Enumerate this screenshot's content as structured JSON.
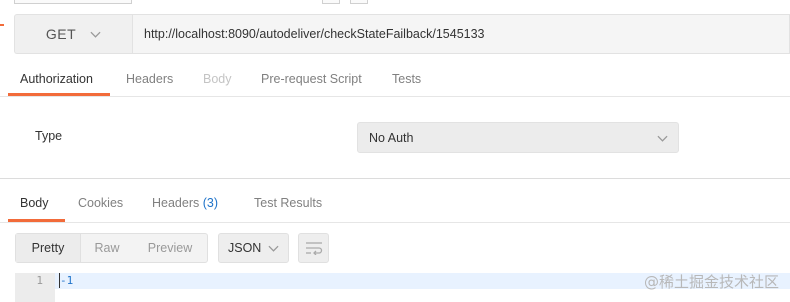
{
  "request": {
    "method": "GET",
    "url": "http://localhost:8090/autodeliver/checkStateFailback/1545133"
  },
  "request_tabs": [
    {
      "label": "Authorization",
      "state": "active"
    },
    {
      "label": "Headers",
      "state": "normal"
    },
    {
      "label": "Body",
      "state": "disabled"
    },
    {
      "label": "Pre-request Script",
      "state": "normal"
    },
    {
      "label": "Tests",
      "state": "normal"
    }
  ],
  "auth": {
    "type_label": "Type",
    "selected": "No Auth"
  },
  "response_tabs": {
    "body": "Body",
    "cookies": "Cookies",
    "headers": "Headers",
    "headers_count": "(3)",
    "test_results": "Test Results"
  },
  "response_toolbar": {
    "pretty": "Pretty",
    "raw": "Raw",
    "preview": "Preview",
    "format": "JSON"
  },
  "response_body": {
    "line_number": "1",
    "content": "-1"
  },
  "watermark": "@稀土掘金技术社区",
  "colors": {
    "accent": "#f26b3a",
    "link": "#1f73c9"
  }
}
